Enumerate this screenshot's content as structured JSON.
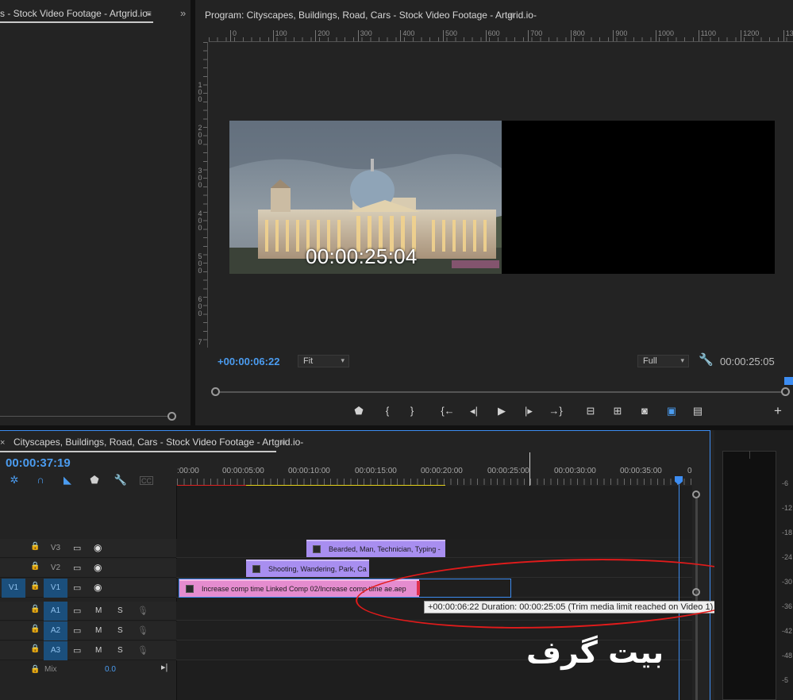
{
  "source_panel": {
    "tab_label": "s - Stock Video Footage - Artgrid.io-",
    "menu_glyph": "≡",
    "collapse_glyph": "»"
  },
  "program_monitor": {
    "title": "Program: Cityscapes, Buildings, Road, Cars - Stock Video Footage - Artgrid.io-",
    "menu_glyph": "≡",
    "ruler_h": [
      "0",
      "100",
      "200",
      "300",
      "400",
      "500",
      "600",
      "700",
      "800",
      "900",
      "1000",
      "1100",
      "1200",
      "13"
    ],
    "ruler_v": [
      "100",
      "200",
      "300",
      "400",
      "500",
      "600",
      "7"
    ],
    "frame_timecode": "00:00:25:04",
    "playhead_offset": "+00:00:06:22",
    "zoom": "Fit",
    "resolution": "Full",
    "duration": "00:00:25:05",
    "transport_icons": [
      "marker-icon",
      "mark-in-icon",
      "mark-out-icon",
      "go-to-in-icon",
      "step-back-icon",
      "play-icon",
      "step-forward-icon",
      "go-to-out-icon",
      "lift-icon",
      "extract-icon",
      "export-frame-icon",
      "comparison-view-icon",
      "multicam-icon",
      "add-button-icon"
    ],
    "transport_glyphs": [
      "⬟",
      "{",
      "}",
      "{←",
      "◂|",
      "▶",
      "|▸",
      "→}",
      "⊟",
      "⊞",
      "◙",
      "▣",
      "▤",
      "+"
    ]
  },
  "timeline": {
    "close_glyph": "×",
    "sequence_title": "Cityscapes, Buildings, Road, Cars - Stock Video Footage - Artgrid.io-",
    "menu_glyph": "≡",
    "timecode": "00:00:37:19",
    "tool_glyphs": [
      "✲",
      "∩",
      "◣",
      "⬟",
      "🔧",
      "CC"
    ],
    "ruler_labels": [
      ":00:00",
      "00:00:05:00",
      "00:00:10:00",
      "00:00:15:00",
      "00:00:20:00",
      "00:00:25:00",
      "00:00:30:00",
      "00:00:35:00",
      "0"
    ],
    "video_tracks": [
      {
        "name": "V3",
        "source": ""
      },
      {
        "name": "V2",
        "source": ""
      },
      {
        "name": "V1",
        "source": "V1"
      }
    ],
    "audio_tracks": [
      {
        "name": "A1",
        "m": "M",
        "s": "S"
      },
      {
        "name": "A2",
        "m": "M",
        "s": "S"
      },
      {
        "name": "A3",
        "m": "M",
        "s": "S"
      }
    ],
    "clips": {
      "v3": "Bearded, Man, Technician, Typing -",
      "v2": "Shooting, Wandering, Park, Ca",
      "v1": "Increase comp time Linked Comp 02/Increase comp time ae.aep"
    },
    "tooltip": "+00:00:06:22 Duration: 00:00:25:05 (Trim media limit reached on Video 1)",
    "mix_label": "Mix",
    "mix_value": "0.0",
    "watermark": "بیت گرف"
  },
  "audio_meter": {
    "labels": [
      "-6",
      "-12",
      "-18",
      "-24",
      "-30",
      "-36",
      "-42",
      "-48",
      "-5"
    ]
  },
  "colors": {
    "accent_blue": "#3d8df2",
    "clip_purple": "#a88ef0",
    "clip_pink": "#e58ccf",
    "annotation_red": "#e21b1b",
    "work_area_yellow": "#e6d21a"
  }
}
